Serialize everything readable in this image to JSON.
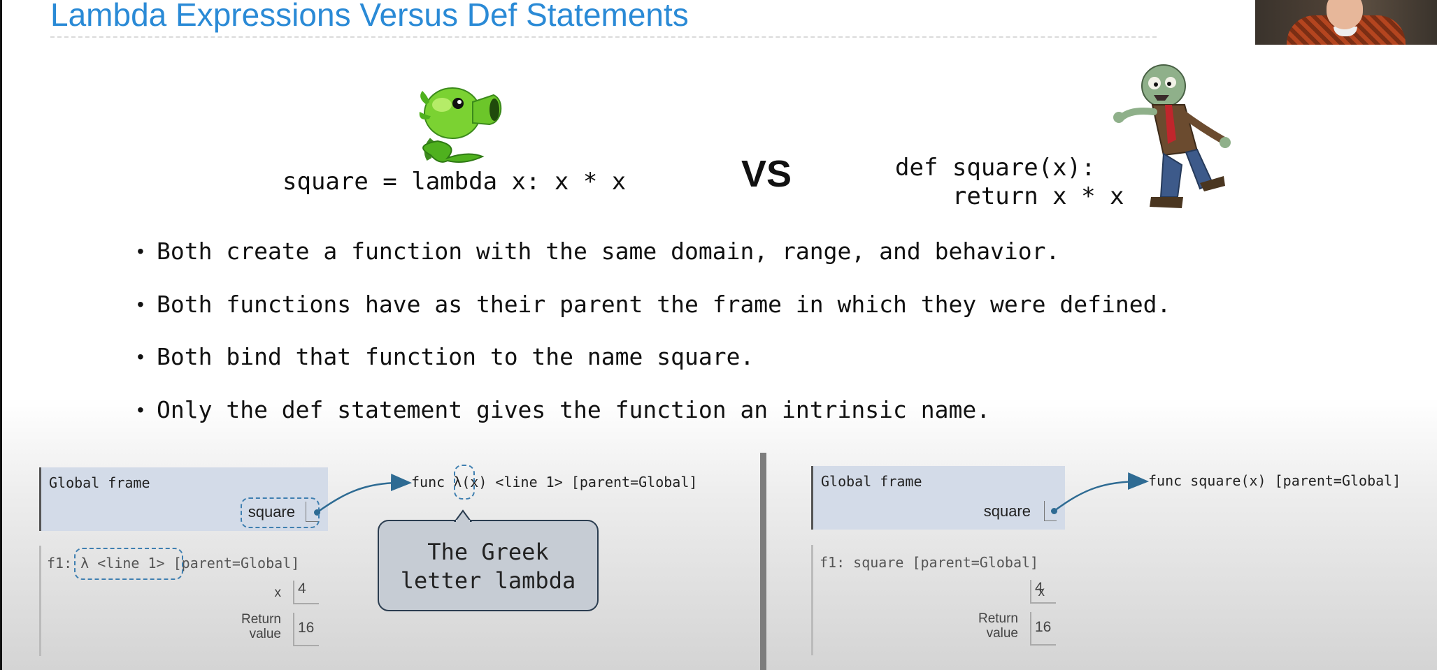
{
  "slide": {
    "title": "Lambda Expressions Versus Def Statements",
    "lambda_code": "square = lambda x: x * x",
    "vs_label": "VS",
    "def_code": "def square(x):\n    return x * x",
    "bullets": [
      "Both create a function with the same domain, range, and behavior.",
      "Both functions have as their parent the frame in which they were defined.",
      "Both bind that function to the name square.",
      "Only the def statement gives the function an intrinsic name."
    ]
  },
  "left_diagram": {
    "global_frame_title": "Global frame",
    "global_var": "square",
    "function_label_prefix": "func ",
    "lambda_symbol": "λ",
    "function_label_suffix": "(x) <line 1> [parent=Global]",
    "f1_prefix": "f1:",
    "f1_name": "λ <line 1>",
    "f1_parent": "[parent=Global]",
    "x_label": "x",
    "x_value": "4",
    "return_label": "Return\nvalue",
    "return_value": "16",
    "callout_text": "The Greek\nletter lambda"
  },
  "right_diagram": {
    "global_frame_title": "Global frame",
    "global_var": "square",
    "function_label": "func square(x) [parent=Global]",
    "f1_header": "f1: square [parent=Global]",
    "x_label": "x",
    "x_value": "4",
    "return_label": "Return\nvalue",
    "return_value": "16"
  },
  "colors": {
    "title": "#2a8ad6",
    "frame_bg": "#d3dbe8",
    "arrow": "#2e6b93",
    "callout_bg": "#c6ccd4"
  },
  "icons": {
    "peashooter": "peashooter-plant-icon",
    "zombie": "zombie-icon"
  }
}
